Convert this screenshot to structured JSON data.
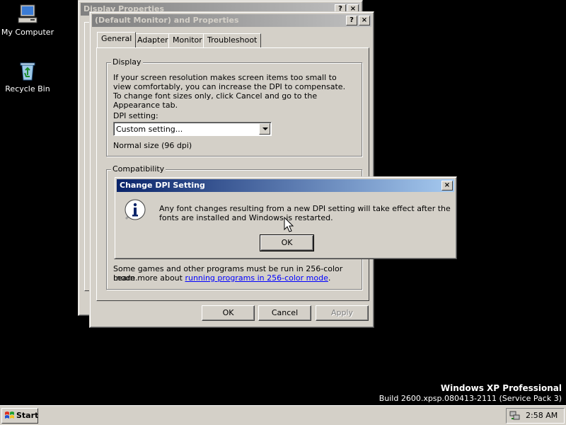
{
  "desktop": {
    "icons": [
      {
        "label": "My Computer",
        "icon": "my-computer-icon"
      },
      {
        "label": "Recycle Bin",
        "icon": "recycle-bin-icon"
      }
    ],
    "watermark": {
      "product": "Windows XP Professional",
      "build": "Build 2600.xpsp.080413-2111 (Service Pack 3)"
    }
  },
  "back_window": {
    "title": "Display Properties",
    "help_label": "?",
    "close_label": "×"
  },
  "monitor_window": {
    "title": "(Default Monitor) and  Properties",
    "help_label": "?",
    "close_label": "×",
    "tabs": [
      {
        "label": "General",
        "selected": true
      },
      {
        "label": "Adapter",
        "selected": false
      },
      {
        "label": "Monitor",
        "selected": false
      },
      {
        "label": "Troubleshoot",
        "selected": false
      }
    ],
    "display_group": {
      "label": "Display",
      "description": "If your screen resolution makes screen items too small to view comfortably, you can increase the DPI to compensate.  To change font sizes only, click Cancel and go to the Appearance tab.",
      "dpi_label": "DPI setting:",
      "dpi_value": "Custom setting...",
      "dpi_note": "Normal size (96 dpi)"
    },
    "compat_group": {
      "label": "Compatibility",
      "text_line1": "Some games and other programs must be run in 256-color mode.",
      "text_prefix": "Learn more about ",
      "link_text": "running programs in 256-color mode",
      "text_suffix": "."
    },
    "buttons": {
      "ok": "OK",
      "cancel": "Cancel",
      "apply": "Apply"
    }
  },
  "dialog": {
    "title": "Change DPI Setting",
    "close_label": "×",
    "icon": "info-icon",
    "message": "Any font changes resulting from a new DPI setting will take effect after the fonts are installed and Windows is restarted.",
    "ok_label": "OK"
  },
  "taskbar": {
    "start_label": "Start",
    "clock": "2:58 AM"
  }
}
